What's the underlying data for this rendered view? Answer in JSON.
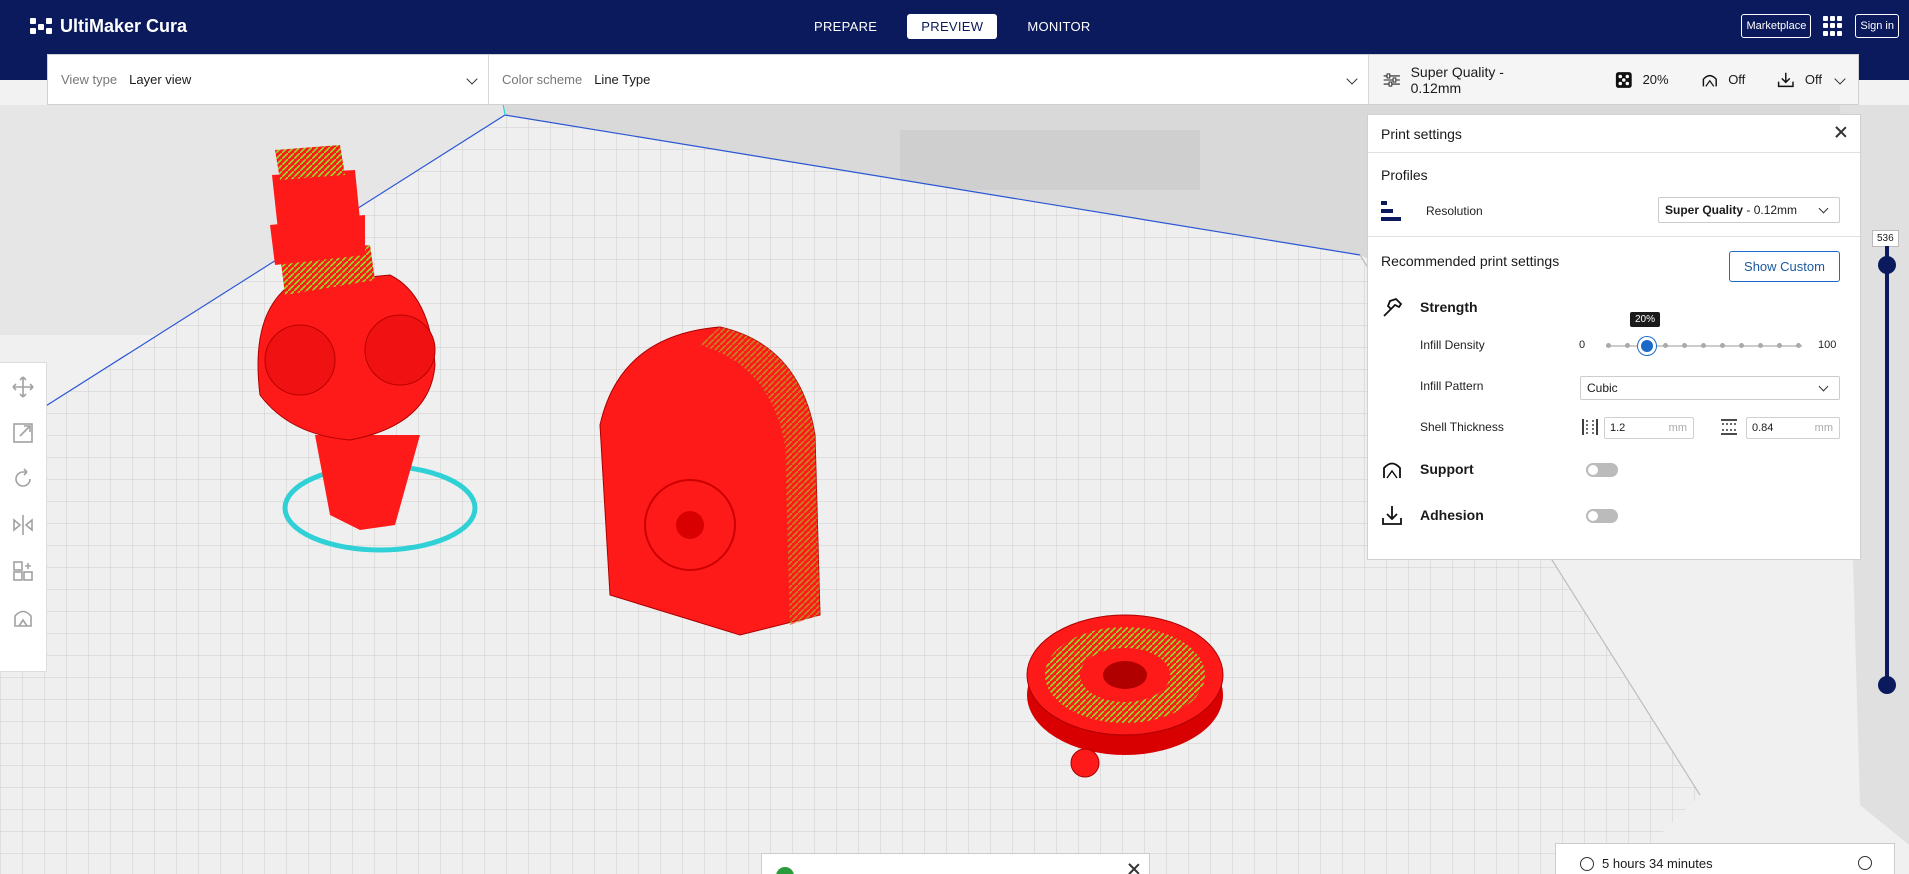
{
  "app": {
    "name": "UltiMaker Cura"
  },
  "stages": [
    {
      "label": "PREPARE",
      "active": false
    },
    {
      "label": "PREVIEW",
      "active": true
    },
    {
      "label": "MONITOR",
      "active": false
    }
  ],
  "top_right": {
    "marketplace": "Marketplace",
    "sign_in": "Sign in"
  },
  "view": {
    "label": "View type",
    "value": "Layer view"
  },
  "color_scheme": {
    "label": "Color scheme",
    "value": "Line Type"
  },
  "print_summary": {
    "profile": "Super Quality - 0.12mm",
    "infill": "20%",
    "support": "Off",
    "adhesion": "Off"
  },
  "print_settings": {
    "title": "Print settings",
    "profiles_label": "Profiles",
    "resolution_label": "Resolution",
    "resolution_bold": "Super Quality",
    "resolution_rest": " - 0.12mm",
    "recommended_label": "Recommended print settings",
    "show_custom": "Show Custom",
    "strength_label": "Strength",
    "infill_density_label": "Infill Density",
    "infill_min": "0",
    "infill_max": "100",
    "infill_tooltip": "20%",
    "infill_value": 20,
    "infill_pattern_label": "Infill Pattern",
    "infill_pattern_value": "Cubic",
    "shell_label": "Shell Thickness",
    "wall_value": "1.2",
    "top_bottom_value": "0.84",
    "unit": "mm",
    "support_label": "Support",
    "support_enabled": false,
    "adhesion_label": "Adhesion",
    "adhesion_enabled": false
  },
  "layer_slider": {
    "value": "536"
  },
  "bottom": {
    "time": "5 hours 34 minutes"
  },
  "colors": {
    "nav": "#0a1a5c",
    "accent": "#1b6ac9",
    "model_red": "#ff1a1a",
    "infill_green": "#8ee02a",
    "skirt_cyan": "#2fd1d6"
  }
}
